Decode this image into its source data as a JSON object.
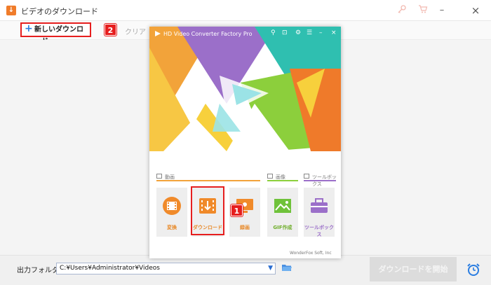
{
  "window": {
    "title": "ビデオのダウンロード",
    "key_icon": "key-icon",
    "cart_icon": "cart-icon",
    "minimize_label": "–",
    "close_label": "×"
  },
  "toolbar": {
    "new_download_label": "新しいダウンロード",
    "clear_label": "クリア"
  },
  "badges": {
    "step1": "1",
    "step2": "2"
  },
  "overlay": {
    "title": "HD Video Converter Factory Pro",
    "sections": {
      "video": "動画",
      "image": "画像",
      "toolbox": "ツールボックス"
    },
    "tiles": [
      {
        "label": "変換",
        "icon": "film-reel-icon"
      },
      {
        "label": "ダウンロード",
        "icon": "download-icon"
      },
      {
        "label": "録画",
        "icon": "screen-record-icon"
      },
      {
        "label": "GIF作成",
        "icon": "gif-image-icon"
      },
      {
        "label": "ツールボックス",
        "icon": "toolbox-icon"
      }
    ],
    "footer": "WonderFox Soft, Inc",
    "colors": {
      "orange": "#f2a33a",
      "purple": "#9b6fc9",
      "teal": "#2fbfb0",
      "green": "#8ccf3c",
      "yellow": "#f7d03c",
      "deep_orange": "#ef7a2a"
    }
  },
  "bottom": {
    "output_label": "出力フォルダ：",
    "output_path": "C:¥Users¥Administrator¥Videos",
    "start_label": "ダウンロードを開始"
  }
}
